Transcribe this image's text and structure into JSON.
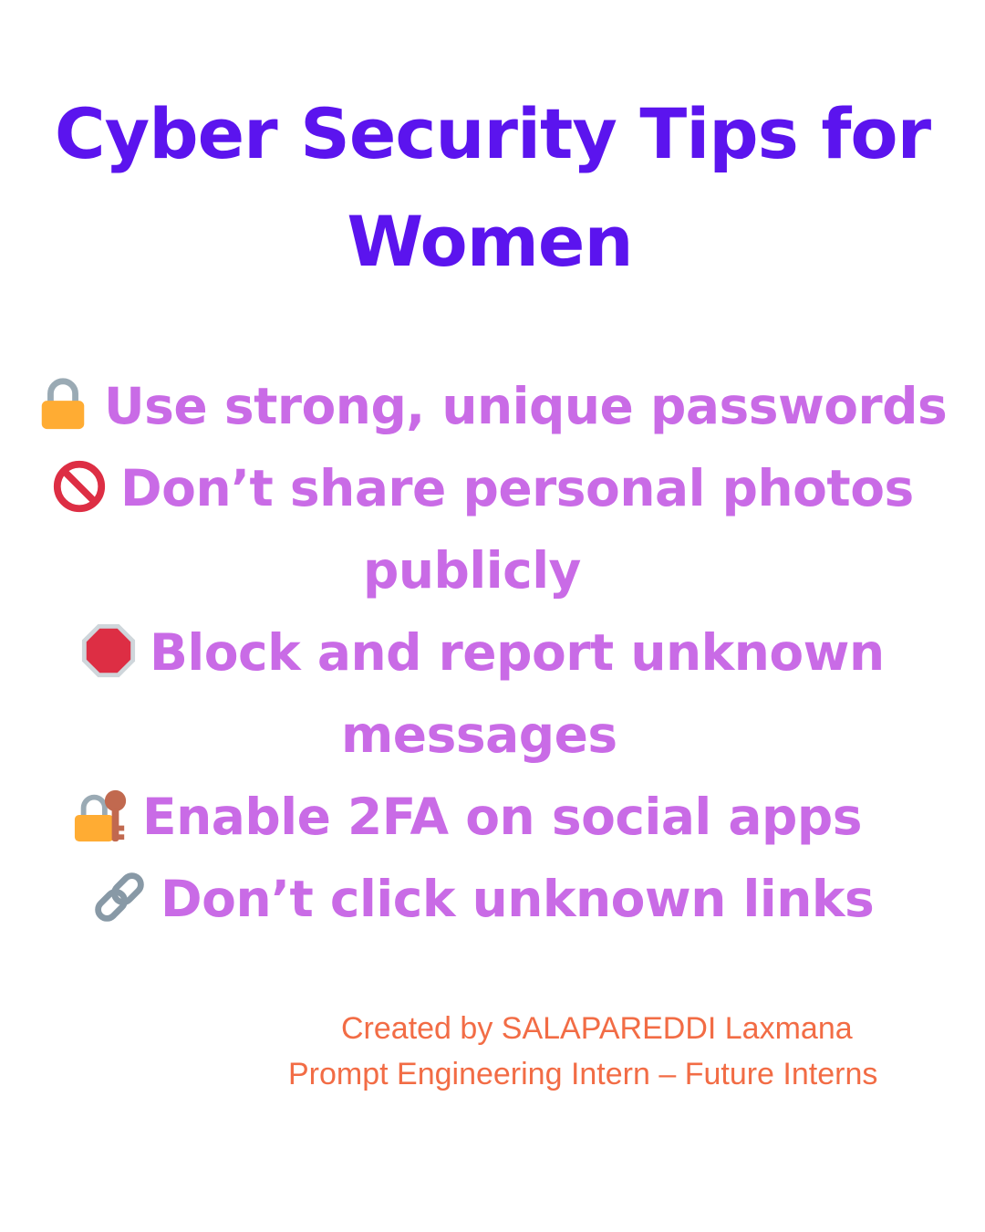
{
  "title": {
    "line1": "Cyber Security Tips for",
    "line2": "Women"
  },
  "colors": {
    "title": "#5b14ee",
    "tips": "#c96be6",
    "credit": "#f26c45",
    "background": "#ffffff"
  },
  "tips": [
    {
      "icon": "lock-icon",
      "line1": "Use strong, unique passwords"
    },
    {
      "icon": "prohibited-icon",
      "line1": "Don’t share personal photos",
      "line2": "publicly"
    },
    {
      "icon": "stop-sign-icon",
      "line1": "Block and report unknown",
      "line2": "messages"
    },
    {
      "icon": "lock-with-key-icon",
      "line1": "Enable 2FA on social apps"
    },
    {
      "icon": "link-icon",
      "line1": "Don’t click unknown links"
    }
  ],
  "credit": {
    "line1": "Created by SALAPAREDDI Laxmana",
    "line2": "Prompt Engineering Intern – Future Interns"
  }
}
